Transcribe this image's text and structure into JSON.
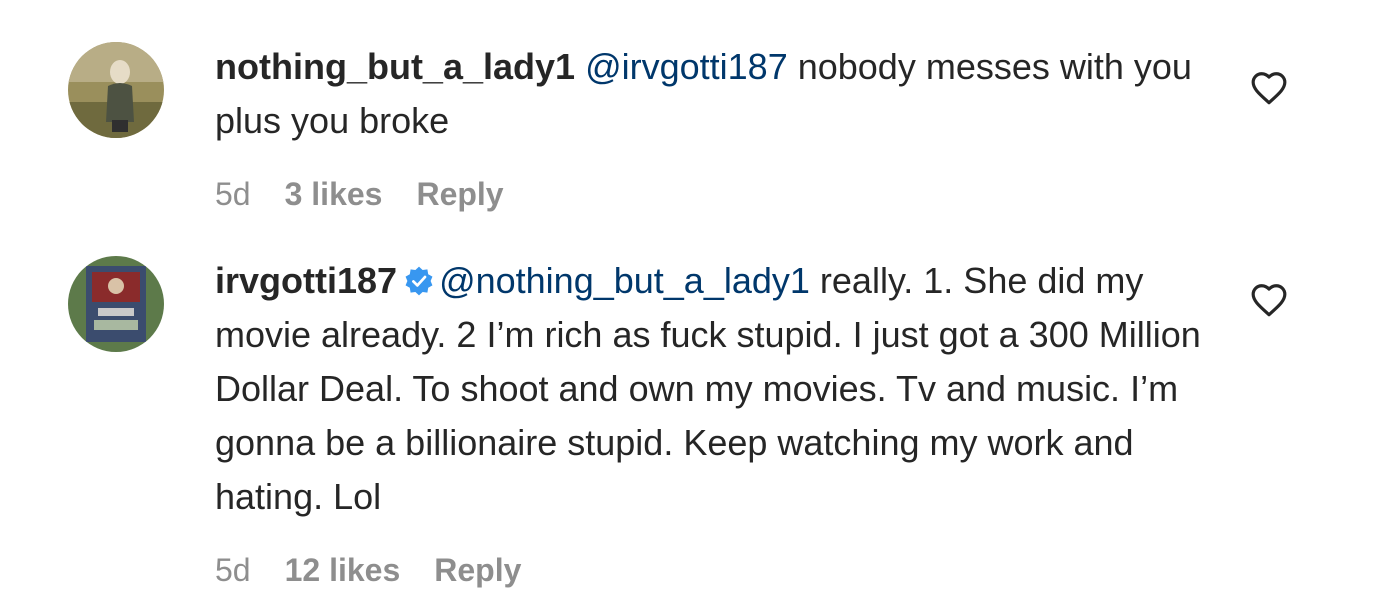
{
  "comments": [
    {
      "username": "nothing_but_a_lady1",
      "verified": false,
      "mention": "@irvgotti187",
      "text": " nobody messes with you plus you broke",
      "time": "5d",
      "likes": "3 likes",
      "reply_label": "Reply",
      "like_icon": "heart-outline-icon"
    },
    {
      "username": "irvgotti187",
      "verified": true,
      "mention": "@nothing_but_a_lady1",
      "text": " really. 1. She did my movie already. 2 I’m rich as fuck stupid. I just got a 300 Million Dollar Deal. To shoot and own my movies. Tv and music. I’m gonna be a billionaire stupid. Keep watching my work and hating. Lol",
      "time": "5d",
      "likes": "12 likes",
      "reply_label": "Reply",
      "like_icon": "heart-outline-icon"
    }
  ],
  "colors": {
    "text": "#262626",
    "mention": "#00376b",
    "meta": "#8e8e8e",
    "verified": "#3897f0"
  }
}
